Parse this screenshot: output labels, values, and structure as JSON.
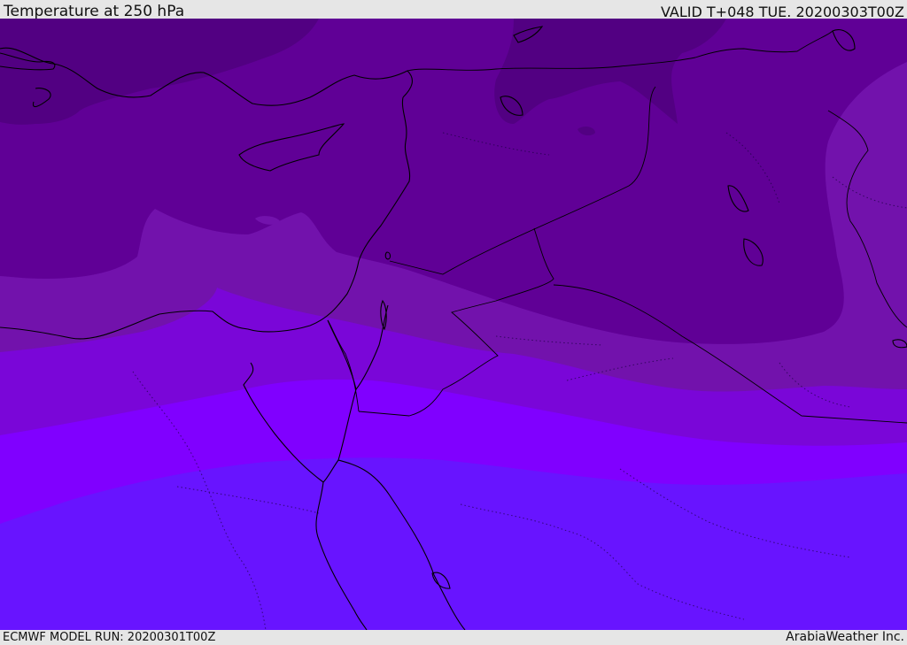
{
  "header": {
    "title": "Temperature at 250 hPa",
    "valid": "VALID T+048 TUE. 20200303T00Z"
  },
  "footer": {
    "model_run": "ECMWF MODEL RUN: 20200301T00Z",
    "credit": "ArabiaWeather Inc."
  },
  "map": {
    "bands": [
      {
        "name": "band-darkest",
        "color": "#520082"
      },
      {
        "name": "band-dark",
        "color": "#600096"
      },
      {
        "name": "band-mid-dark",
        "color": "#7212ac"
      },
      {
        "name": "band-mid",
        "color": "#7a06d8"
      },
      {
        "name": "band-bright",
        "color": "#8000ff"
      },
      {
        "name": "band-blue-violet",
        "color": "#6814ff"
      }
    ],
    "coastline_color": "#000000",
    "border_style": "dotted"
  }
}
